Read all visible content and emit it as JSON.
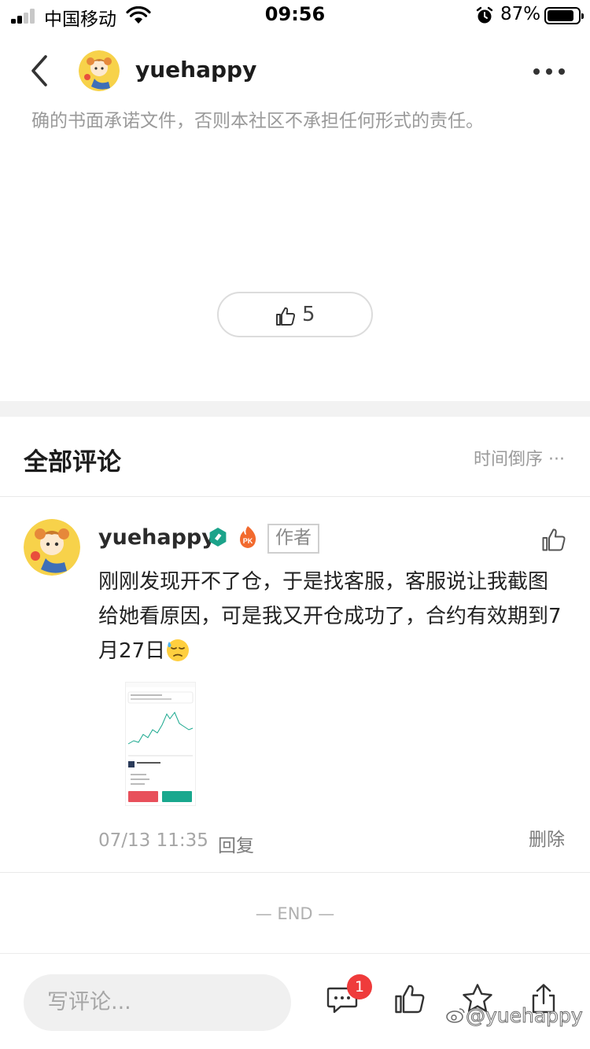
{
  "status_bar": {
    "carrier": "中国移动",
    "time": "09:56",
    "battery_percent": "87%",
    "battery_level": 0.87
  },
  "nav": {
    "title": "yuehappy",
    "back_icon": "chevron-left-icon",
    "more_icon": "more-dots-icon"
  },
  "post": {
    "disclaimer_tail": "确的书面承诺文件，否则本社区不承担任何形式的责任。",
    "like_count": "5"
  },
  "comments_section": {
    "title": "全部评论",
    "sort_label": "时间倒序 ···"
  },
  "comment": {
    "author": "yuehappy",
    "author_tag": "作者",
    "text": "刚刚发现开不了仓，于是找客服，客服说让我截图给她看原因，可是我又开仓成功了，合约有效期到7月27日",
    "timestamp": "07/13 11:35",
    "reply_label": "回复",
    "delete_label": "删除"
  },
  "end_marker": "— END —",
  "bottom_bar": {
    "input_placeholder": "写评论...",
    "comment_badge": "1",
    "watermark": "@yuehappy"
  },
  "colors": {
    "badge_red": "#ef3b3b",
    "verified_green": "#1ba38a",
    "pk_orange": "#f26a2e",
    "chart_green": "#19a88e",
    "chart_red": "#e8505b"
  }
}
